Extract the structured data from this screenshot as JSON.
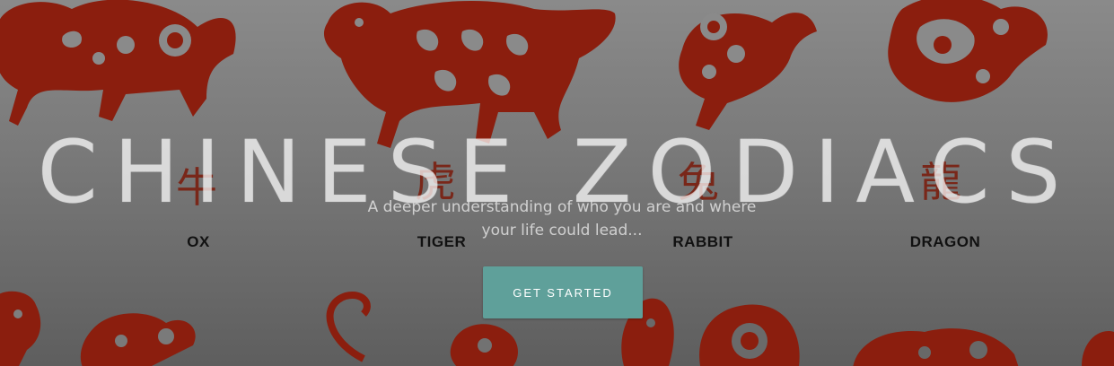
{
  "hero": {
    "title": "CHINESE ZODIACS",
    "subtitle": "A deeper understanding of who you are and where your life could lead...",
    "cta_label": "GET STARTED"
  },
  "background": {
    "zodiacs": [
      {
        "char": "牛",
        "name": "OX",
        "icon": "ox-papercut-icon"
      },
      {
        "char": "虎",
        "name": "TIGER",
        "icon": "tiger-papercut-icon"
      },
      {
        "char": "兔",
        "name": "RABBIT",
        "icon": "rabbit-papercut-icon"
      },
      {
        "char": "龍",
        "name": "DRAGON",
        "icon": "dragon-papercut-icon"
      }
    ],
    "bottom_icons": [
      "horse-papercut-icon",
      "goat-papercut-icon",
      "monkey-papercut-icon",
      "rooster-papercut-icon",
      "dog-papercut-icon",
      "pig-papercut-icon"
    ]
  },
  "colors": {
    "papercut": "#8b1e0e",
    "button": "#5fa09a",
    "overlay": "#7a7a7a"
  }
}
